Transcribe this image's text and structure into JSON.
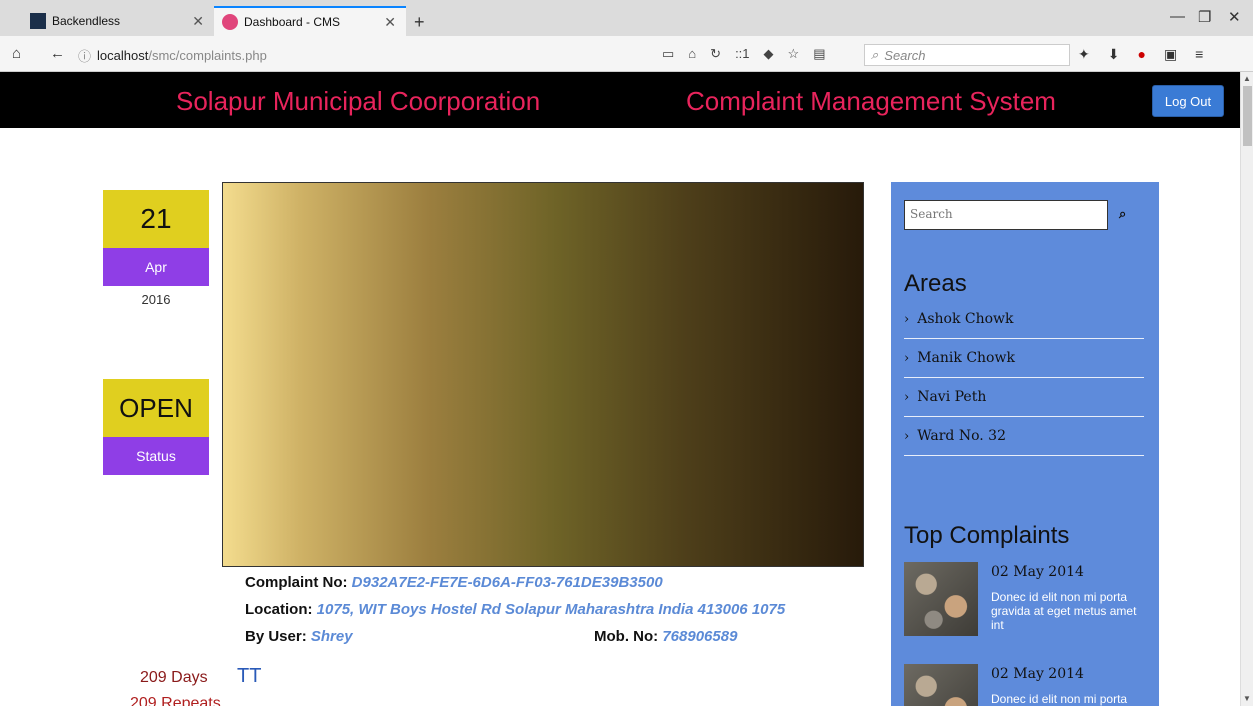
{
  "browser": {
    "tabs": [
      {
        "title": "Backendless",
        "active": false
      },
      {
        "title": "Dashboard - CMS",
        "active": true
      }
    ],
    "url_host": "localhost",
    "url_path": "/smc/complaints.php",
    "search_placeholder": "Search",
    "zoom_indicator": "::1"
  },
  "header": {
    "left_title": "Solapur Municipal Coorporation",
    "right_title": "Complaint Management System",
    "logout_label": "Log Out"
  },
  "date": {
    "day": "21",
    "month": "Apr",
    "year": "2016"
  },
  "status": {
    "value": "OPEN",
    "label": "Status"
  },
  "complaint": {
    "no_label": "Complaint No:",
    "no_value": "D932A7E2-FE7E-6D6A-FF03-761DE39B3500",
    "location_label": "Location:",
    "location_value": "1075, WIT Boys Hostel Rd Solapur Maharashtra India 413006 1075",
    "user_label": "By User:",
    "user_value": "Shrey",
    "mob_label": "Mob. No:",
    "mob_value": "768906589"
  },
  "stats": {
    "days": "209 Days",
    "repeats": "209 Repeats",
    "title": "TT"
  },
  "sidebar": {
    "search_placeholder": "Search",
    "areas_heading": "Areas",
    "areas": [
      "Ashok Chowk",
      "Manik Chowk",
      "Navi Peth",
      "Ward No. 32"
    ],
    "top_heading": "Top Complaints",
    "top_complaints": [
      {
        "date": "02 May 2014",
        "text": "Donec id elit non mi porta gravida at eget metus amet int"
      },
      {
        "date": "02 May 2014",
        "text": "Donec id elit non mi porta"
      }
    ]
  },
  "colors": {
    "accent_pink": "#e8245c",
    "yellow": "#e0cf1f",
    "purple": "#8f3ee6",
    "sidebar_blue": "#5e8bdb"
  }
}
